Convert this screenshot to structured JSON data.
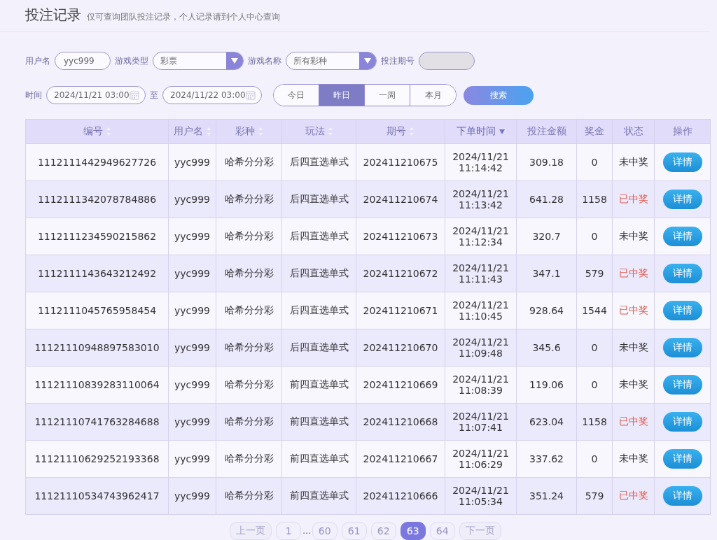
{
  "header": {
    "title": "投注记录",
    "subtitle": "仅可查询团队投注记录，个人记录请到个人中心查询"
  },
  "filters": {
    "username": {
      "label": "用户名",
      "value": "yyc999"
    },
    "game_type": {
      "label": "游戏类型",
      "value": "彩票"
    },
    "game_name": {
      "label": "游戏名称",
      "value": "所有彩种"
    },
    "issue": {
      "label": "投注期号",
      "disabled": true
    },
    "time_label": "时间",
    "start": "2024/11/21 03:00",
    "to_label": "至",
    "end": "2024/11/22 03:00",
    "periods": [
      {
        "label": "今日",
        "selected": false
      },
      {
        "label": "昨日",
        "selected": true
      },
      {
        "label": "一周",
        "selected": false
      },
      {
        "label": "本月",
        "selected": false
      }
    ],
    "search_button": "搜索"
  },
  "table": {
    "columns": [
      {
        "label": "编号",
        "sortable": true,
        "sorted": false
      },
      {
        "label": "用户名",
        "sortable": true,
        "sorted": false
      },
      {
        "label": "彩种",
        "sortable": true,
        "sorted": false
      },
      {
        "label": "玩法",
        "sortable": true,
        "sorted": false
      },
      {
        "label": "期号",
        "sortable": true,
        "sorted": false
      },
      {
        "label": "下单时间",
        "sortable": true,
        "sorted": true
      },
      {
        "label": "投注金额",
        "sortable": false
      },
      {
        "label": "奖金",
        "sortable": false
      },
      {
        "label": "状态",
        "sortable": false
      },
      {
        "label": "操作",
        "sortable": false
      }
    ],
    "rows": [
      {
        "id": "1112111442949627726",
        "user": "yyc999",
        "lottery": "哈希分分彩",
        "play": "后四直选单式",
        "issue": "202411210675",
        "date": "2024/11/21",
        "time": "11:14:42",
        "amount": "309.18",
        "prize": "0",
        "status": "未中奖",
        "won": false,
        "action": "详情"
      },
      {
        "id": "1112111342078784886",
        "user": "yyc999",
        "lottery": "哈希分分彩",
        "play": "后四直选单式",
        "issue": "202411210674",
        "date": "2024/11/21",
        "time": "11:13:42",
        "amount": "641.28",
        "prize": "1158",
        "status": "已中奖",
        "won": true,
        "action": "详情"
      },
      {
        "id": "1112111234590215862",
        "user": "yyc999",
        "lottery": "哈希分分彩",
        "play": "后四直选单式",
        "issue": "202411210673",
        "date": "2024/11/21",
        "time": "11:12:34",
        "amount": "320.7",
        "prize": "0",
        "status": "未中奖",
        "won": false,
        "action": "详情"
      },
      {
        "id": "1112111143643212492",
        "user": "yyc999",
        "lottery": "哈希分分彩",
        "play": "后四直选单式",
        "issue": "202411210672",
        "date": "2024/11/21",
        "time": "11:11:43",
        "amount": "347.1",
        "prize": "579",
        "status": "已中奖",
        "won": true,
        "action": "详情"
      },
      {
        "id": "1112111045765958454",
        "user": "yyc999",
        "lottery": "哈希分分彩",
        "play": "后四直选单式",
        "issue": "202411210671",
        "date": "2024/11/21",
        "time": "11:10:45",
        "amount": "928.64",
        "prize": "1544",
        "status": "已中奖",
        "won": true,
        "action": "详情"
      },
      {
        "id": "11121110948897583010",
        "user": "yyc999",
        "lottery": "哈希分分彩",
        "play": "后四直选单式",
        "issue": "202411210670",
        "date": "2024/11/21",
        "time": "11:09:48",
        "amount": "345.6",
        "prize": "0",
        "status": "未中奖",
        "won": false,
        "action": "详情"
      },
      {
        "id": "11121110839283110064",
        "user": "yyc999",
        "lottery": "哈希分分彩",
        "play": "前四直选单式",
        "issue": "202411210669",
        "date": "2024/11/21",
        "time": "11:08:39",
        "amount": "119.06",
        "prize": "0",
        "status": "未中奖",
        "won": false,
        "action": "详情"
      },
      {
        "id": "11121110741763284688",
        "user": "yyc999",
        "lottery": "哈希分分彩",
        "play": "前四直选单式",
        "issue": "202411210668",
        "date": "2024/11/21",
        "time": "11:07:41",
        "amount": "623.04",
        "prize": "1158",
        "status": "已中奖",
        "won": true,
        "action": "详情"
      },
      {
        "id": "11121110629252193368",
        "user": "yyc999",
        "lottery": "哈希分分彩",
        "play": "前四直选单式",
        "issue": "202411210667",
        "date": "2024/11/21",
        "time": "11:06:29",
        "amount": "337.62",
        "prize": "0",
        "status": "未中奖",
        "won": false,
        "action": "详情"
      },
      {
        "id": "11121110534743962417",
        "user": "yyc999",
        "lottery": "哈希分分彩",
        "play": "前四直选单式",
        "issue": "202411210666",
        "date": "2024/11/21",
        "time": "11:05:34",
        "amount": "351.24",
        "prize": "579",
        "status": "已中奖",
        "won": true,
        "action": "详情"
      }
    ]
  },
  "pagination": [
    {
      "kind": "prev",
      "label": "上一页",
      "disabled": true
    },
    {
      "kind": "page",
      "label": "1",
      "selected": false
    },
    {
      "kind": "ellipsis",
      "label": "..."
    },
    {
      "kind": "page",
      "label": "60",
      "selected": false
    },
    {
      "kind": "page",
      "label": "61",
      "selected": false
    },
    {
      "kind": "page",
      "label": "62",
      "selected": false
    },
    {
      "kind": "page",
      "label": "63",
      "selected": true
    },
    {
      "kind": "page",
      "label": "64",
      "selected": false
    },
    {
      "kind": "next",
      "label": "下一页",
      "disabled": true
    }
  ]
}
